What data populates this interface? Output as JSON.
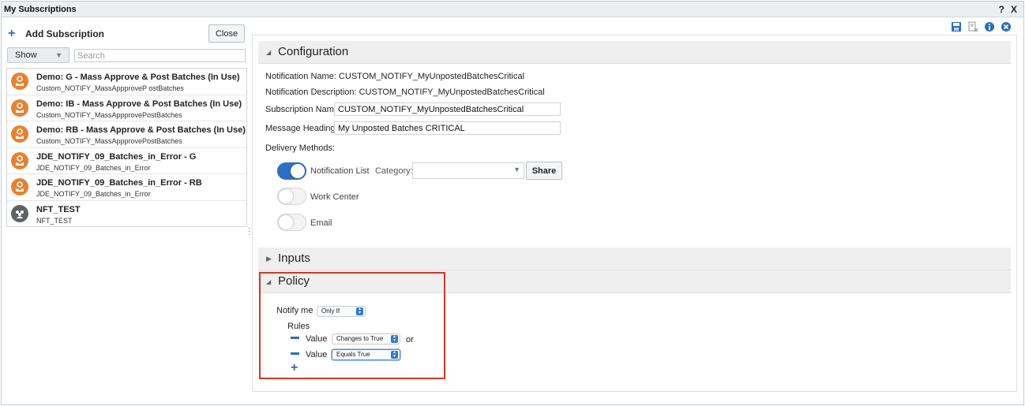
{
  "window": {
    "title": "My Subscriptions",
    "help_label": "?",
    "close_label": "X"
  },
  "left": {
    "add_label": "Add Subscription",
    "close_label": "Close",
    "show_label": "Show",
    "search_placeholder": "Search",
    "items": [
      {
        "name": "Demo: G - Mass Approve & Post Batches (In Use)",
        "sub": "Custom_NOTIFY_MassAppproveP ostBatches",
        "avatar": "person-icon"
      },
      {
        "name": "Demo: IB - Mass Approve & Post Batches (In Use)",
        "sub": "Custom_NOTIFY_MassAppprovePostBatches",
        "avatar": "person-icon"
      },
      {
        "name": "Demo: RB - Mass Approve & Post Batches (In Use)",
        "sub": "Custom_NOTIFY_MassAppprovePostBatches",
        "avatar": "person-icon"
      },
      {
        "name": "JDE_NOTIFY_09_Batches_in_Error - G",
        "sub": "JDE_NOTIFY_09_Batches_in_Error",
        "avatar": "person-icon"
      },
      {
        "name": "JDE_NOTIFY_09_Batches_in_Error - RB",
        "sub": "JDE_NOTIFY_09_Batches_in_Error",
        "avatar": "person-icon"
      },
      {
        "name": "NFT_TEST",
        "sub": "NFT_TEST",
        "avatar": "group-icon"
      }
    ]
  },
  "toolbar": {
    "icons": [
      "save-icon",
      "delete-icon",
      "info-icon",
      "close-circle-icon"
    ]
  },
  "configuration": {
    "title": "Configuration",
    "notification_name": "Notification Name: CUSTOM_NOTIFY_MyUnpostedBatchesCritical",
    "notification_description": "Notification Description: CUSTOM_NOTIFY_MyUnpostedBatchesCritical",
    "subscription_name_label": "Subscription Name:",
    "subscription_name_value": "CUSTOM_NOTIFY_MyUnpostedBatchesCritical",
    "message_heading_label": "Message Heading:",
    "message_heading_value": "My Unposted Batches CRITICAL",
    "delivery_methods_label": "Delivery Methods:",
    "methods": [
      {
        "label": "Notification List",
        "on": true
      },
      {
        "label": "Work Center",
        "on": false
      },
      {
        "label": "Email",
        "on": false
      }
    ],
    "category_label": "Category:",
    "category_value": "",
    "share_label": "Share"
  },
  "inputs": {
    "title": "Inputs"
  },
  "policy": {
    "title": "Policy",
    "notify_me_label": "Notify me",
    "notify_me_value": "Only If",
    "rules_label": "Rules",
    "rules": [
      {
        "label": "Value",
        "condition": "Changes to True",
        "joiner": "or"
      },
      {
        "label": "Value",
        "condition": "Equals True",
        "joiner": ""
      }
    ]
  },
  "colors": {
    "accent": "#2e6fc2",
    "avatar_orange": "#e8822f",
    "highlight": "#d03a22"
  }
}
